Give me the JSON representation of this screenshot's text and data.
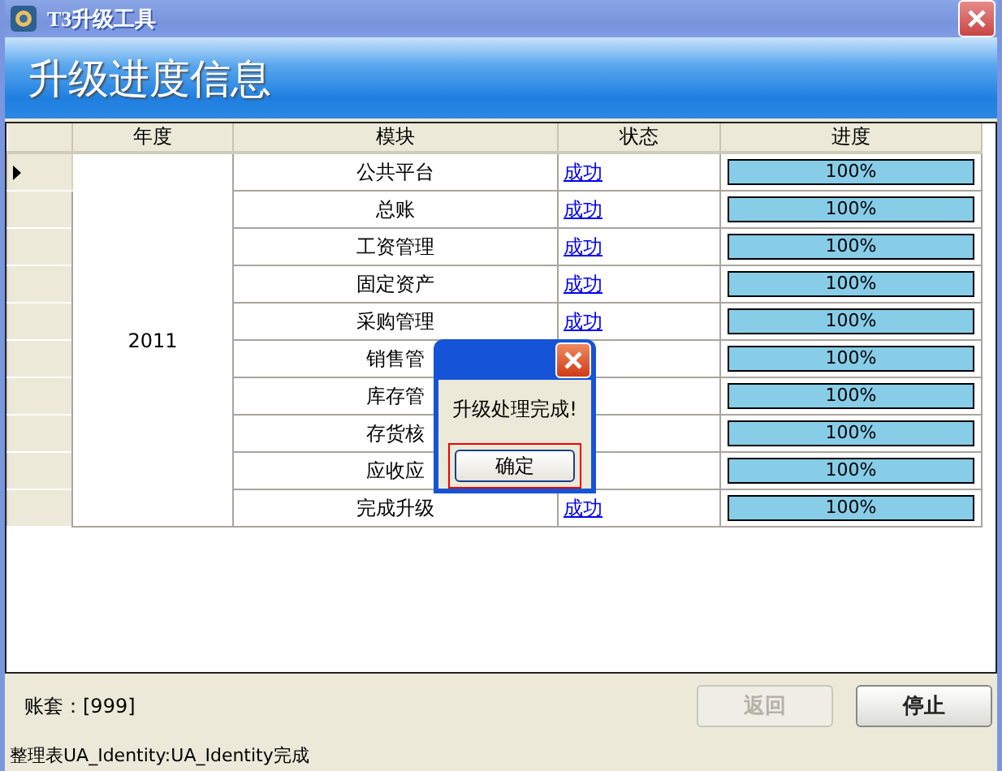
{
  "window": {
    "title": "T3升级工具"
  },
  "banner": {
    "title": "升级进度信息"
  },
  "table": {
    "columns": [
      "年度",
      "模块",
      "状态",
      "进度"
    ],
    "year": "2011",
    "rows": [
      {
        "selected": true,
        "module": "公共平台",
        "status": "成功",
        "level": 1,
        "progress": "100%"
      },
      {
        "selected": false,
        "module": "总账",
        "status": "成功",
        "level": 1,
        "progress": "100%"
      },
      {
        "selected": false,
        "module": "工资管理",
        "status": "成功",
        "level": 1,
        "progress": "100%"
      },
      {
        "selected": false,
        "module": "固定资产",
        "status": "成功",
        "level": 1,
        "progress": "100%"
      },
      {
        "selected": false,
        "module": "采购管理",
        "status": "成功",
        "level": 1,
        "progress": "100%"
      },
      {
        "selected": false,
        "module": "销售管",
        "level": 1,
        "progress": "100%"
      },
      {
        "selected": false,
        "module": "库存管",
        "level": 1,
        "progress": "100%"
      },
      {
        "selected": false,
        "module": "存货核",
        "level": 1,
        "progress": "100%"
      },
      {
        "selected": false,
        "module": "应收应",
        "level": 1,
        "progress": "100%"
      },
      {
        "selected": false,
        "module": "完成升级",
        "status": "成功",
        "level": 1,
        "progress": "100%"
      }
    ]
  },
  "dialog": {
    "message": "升级处理完成!",
    "button": "确定"
  },
  "account": "账套：[999]",
  "buttons": [
    {
      "label": "返回",
      "disabled": true
    },
    {
      "label": "停止",
      "disabled": false
    }
  ],
  "status_bar": "整理表UA_Identity:UA_Identity完成"
}
